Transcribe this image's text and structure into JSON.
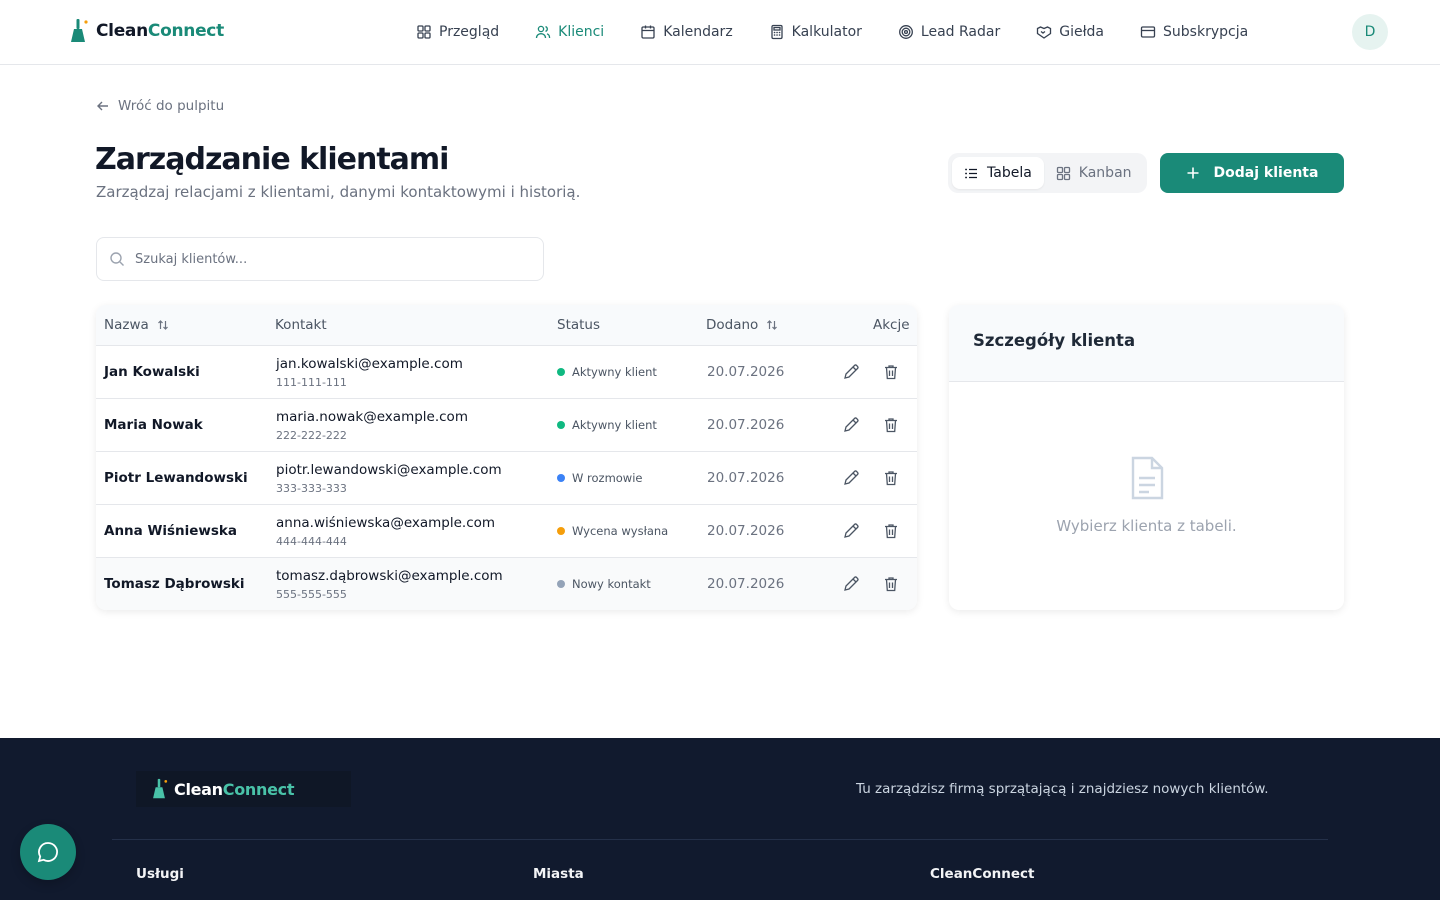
{
  "brand": {
    "part1": "Clean",
    "part2": "Connect"
  },
  "nav": [
    {
      "label": "Przegląd",
      "icon": "grid-icon"
    },
    {
      "label": "Klienci",
      "icon": "users-icon",
      "active": true
    },
    {
      "label": "Kalendarz",
      "icon": "calendar-icon"
    },
    {
      "label": "Kalkulator",
      "icon": "calculator-icon"
    },
    {
      "label": "Lead Radar",
      "icon": "target-icon"
    },
    {
      "label": "Giełda",
      "icon": "handshake-icon"
    },
    {
      "label": "Subskrypcja",
      "icon": "credit-card-icon"
    }
  ],
  "user": {
    "initial": "D"
  },
  "back_link": "Wróć do pulpitu",
  "page": {
    "title": "Zarządzanie klientami",
    "subtitle": "Zarządzaj relacjami z klientami, danymi kontaktowymi i historią."
  },
  "view_toggle": {
    "table": "Tabela",
    "kanban": "Kanban",
    "selected": "Tabela"
  },
  "add_button": "Dodaj klienta",
  "search": {
    "placeholder": "Szukaj klientów...",
    "value": ""
  },
  "table": {
    "headers": {
      "name": "Nazwa",
      "contact": "Kontakt",
      "status": "Status",
      "added": "Dodano",
      "actions": "Akcje"
    },
    "rows": [
      {
        "name": "Jan Kowalski",
        "email": "jan.kowalski@example.com",
        "phone": "111-111-111",
        "status": "Aktywny klient",
        "status_color": "#10b981",
        "added": "20.07.2026"
      },
      {
        "name": "Maria Nowak",
        "email": "maria.nowak@example.com",
        "phone": "222-222-222",
        "status": "Aktywny klient",
        "status_color": "#10b981",
        "added": "20.07.2026"
      },
      {
        "name": "Piotr Lewandowski",
        "email": "piotr.lewandowski@example.com",
        "phone": "333-333-333",
        "status": "W rozmowie",
        "status_color": "#3b82f6",
        "added": "20.07.2026"
      },
      {
        "name": "Anna Wiśniewska",
        "email": "anna.wiśniewska@example.com",
        "phone": "444-444-444",
        "status": "Wycena wysłana",
        "status_color": "#f59e0b",
        "added": "20.07.2026"
      },
      {
        "name": "Tomasz Dąbrowski",
        "email": "tomasz.dąbrowski@example.com",
        "phone": "555-555-555",
        "status": "Nowy kontakt",
        "status_color": "#94a3b8",
        "added": "20.07.2026"
      }
    ]
  },
  "details": {
    "title": "Szczegóły klienta",
    "empty": "Wybierz klienta z tabeli."
  },
  "footer": {
    "tagline": "Tu zarządzisz firmą sprzątającą i znajdziesz nowych klientów.",
    "columns": [
      "Usługi",
      "Miasta",
      "CleanConnect"
    ]
  },
  "colors": {
    "accent": "#1a8a78",
    "footer_bg": "#111a2e"
  }
}
